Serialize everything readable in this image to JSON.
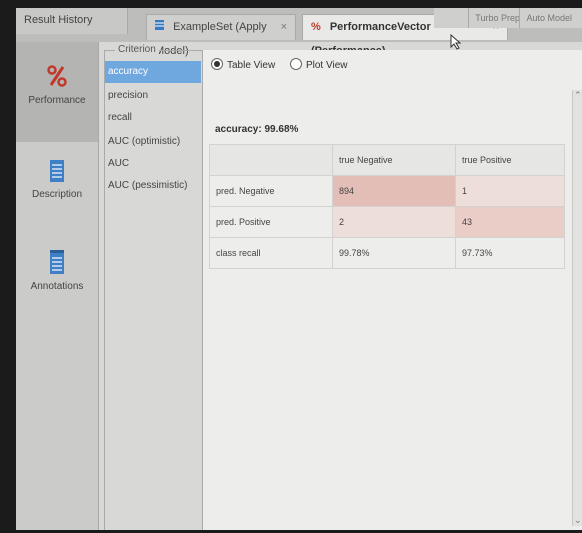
{
  "tabs": {
    "result_history": "Result History",
    "exampleset": "ExampleSet (Apply Model)",
    "performance": "PerformanceVector (Performance)",
    "close_glyph": "×"
  },
  "top_buttons": {
    "turbo_prep": "Turbo Prep",
    "auto_model": "Auto Model"
  },
  "rail": {
    "performance": "Performance",
    "description": "Description",
    "annotations": "Annotations"
  },
  "criterion": {
    "title": "Criterion",
    "items": [
      "accuracy",
      "precision",
      "recall",
      "AUC (optimistic)",
      "AUC",
      "AUC (pessimistic)"
    ],
    "selected": "accuracy"
  },
  "view": {
    "table_view": "Table View",
    "plot_view": "Plot View",
    "selected": "Table View"
  },
  "result": {
    "title": "accuracy: 99.68%",
    "col_headers": [
      "",
      "true Negative",
      "true Positive"
    ],
    "rows": [
      {
        "label": "pred. Negative",
        "values": [
          "894",
          "1"
        ]
      },
      {
        "label": "pred. Positive",
        "values": [
          "2",
          "43"
        ]
      },
      {
        "label": "class recall",
        "values": [
          "99.78%",
          "97.73%"
        ]
      }
    ]
  },
  "colors": {
    "selection": "#6fa7df",
    "matrix_high": "#e3beb6",
    "matrix_low": "#eeded9"
  }
}
